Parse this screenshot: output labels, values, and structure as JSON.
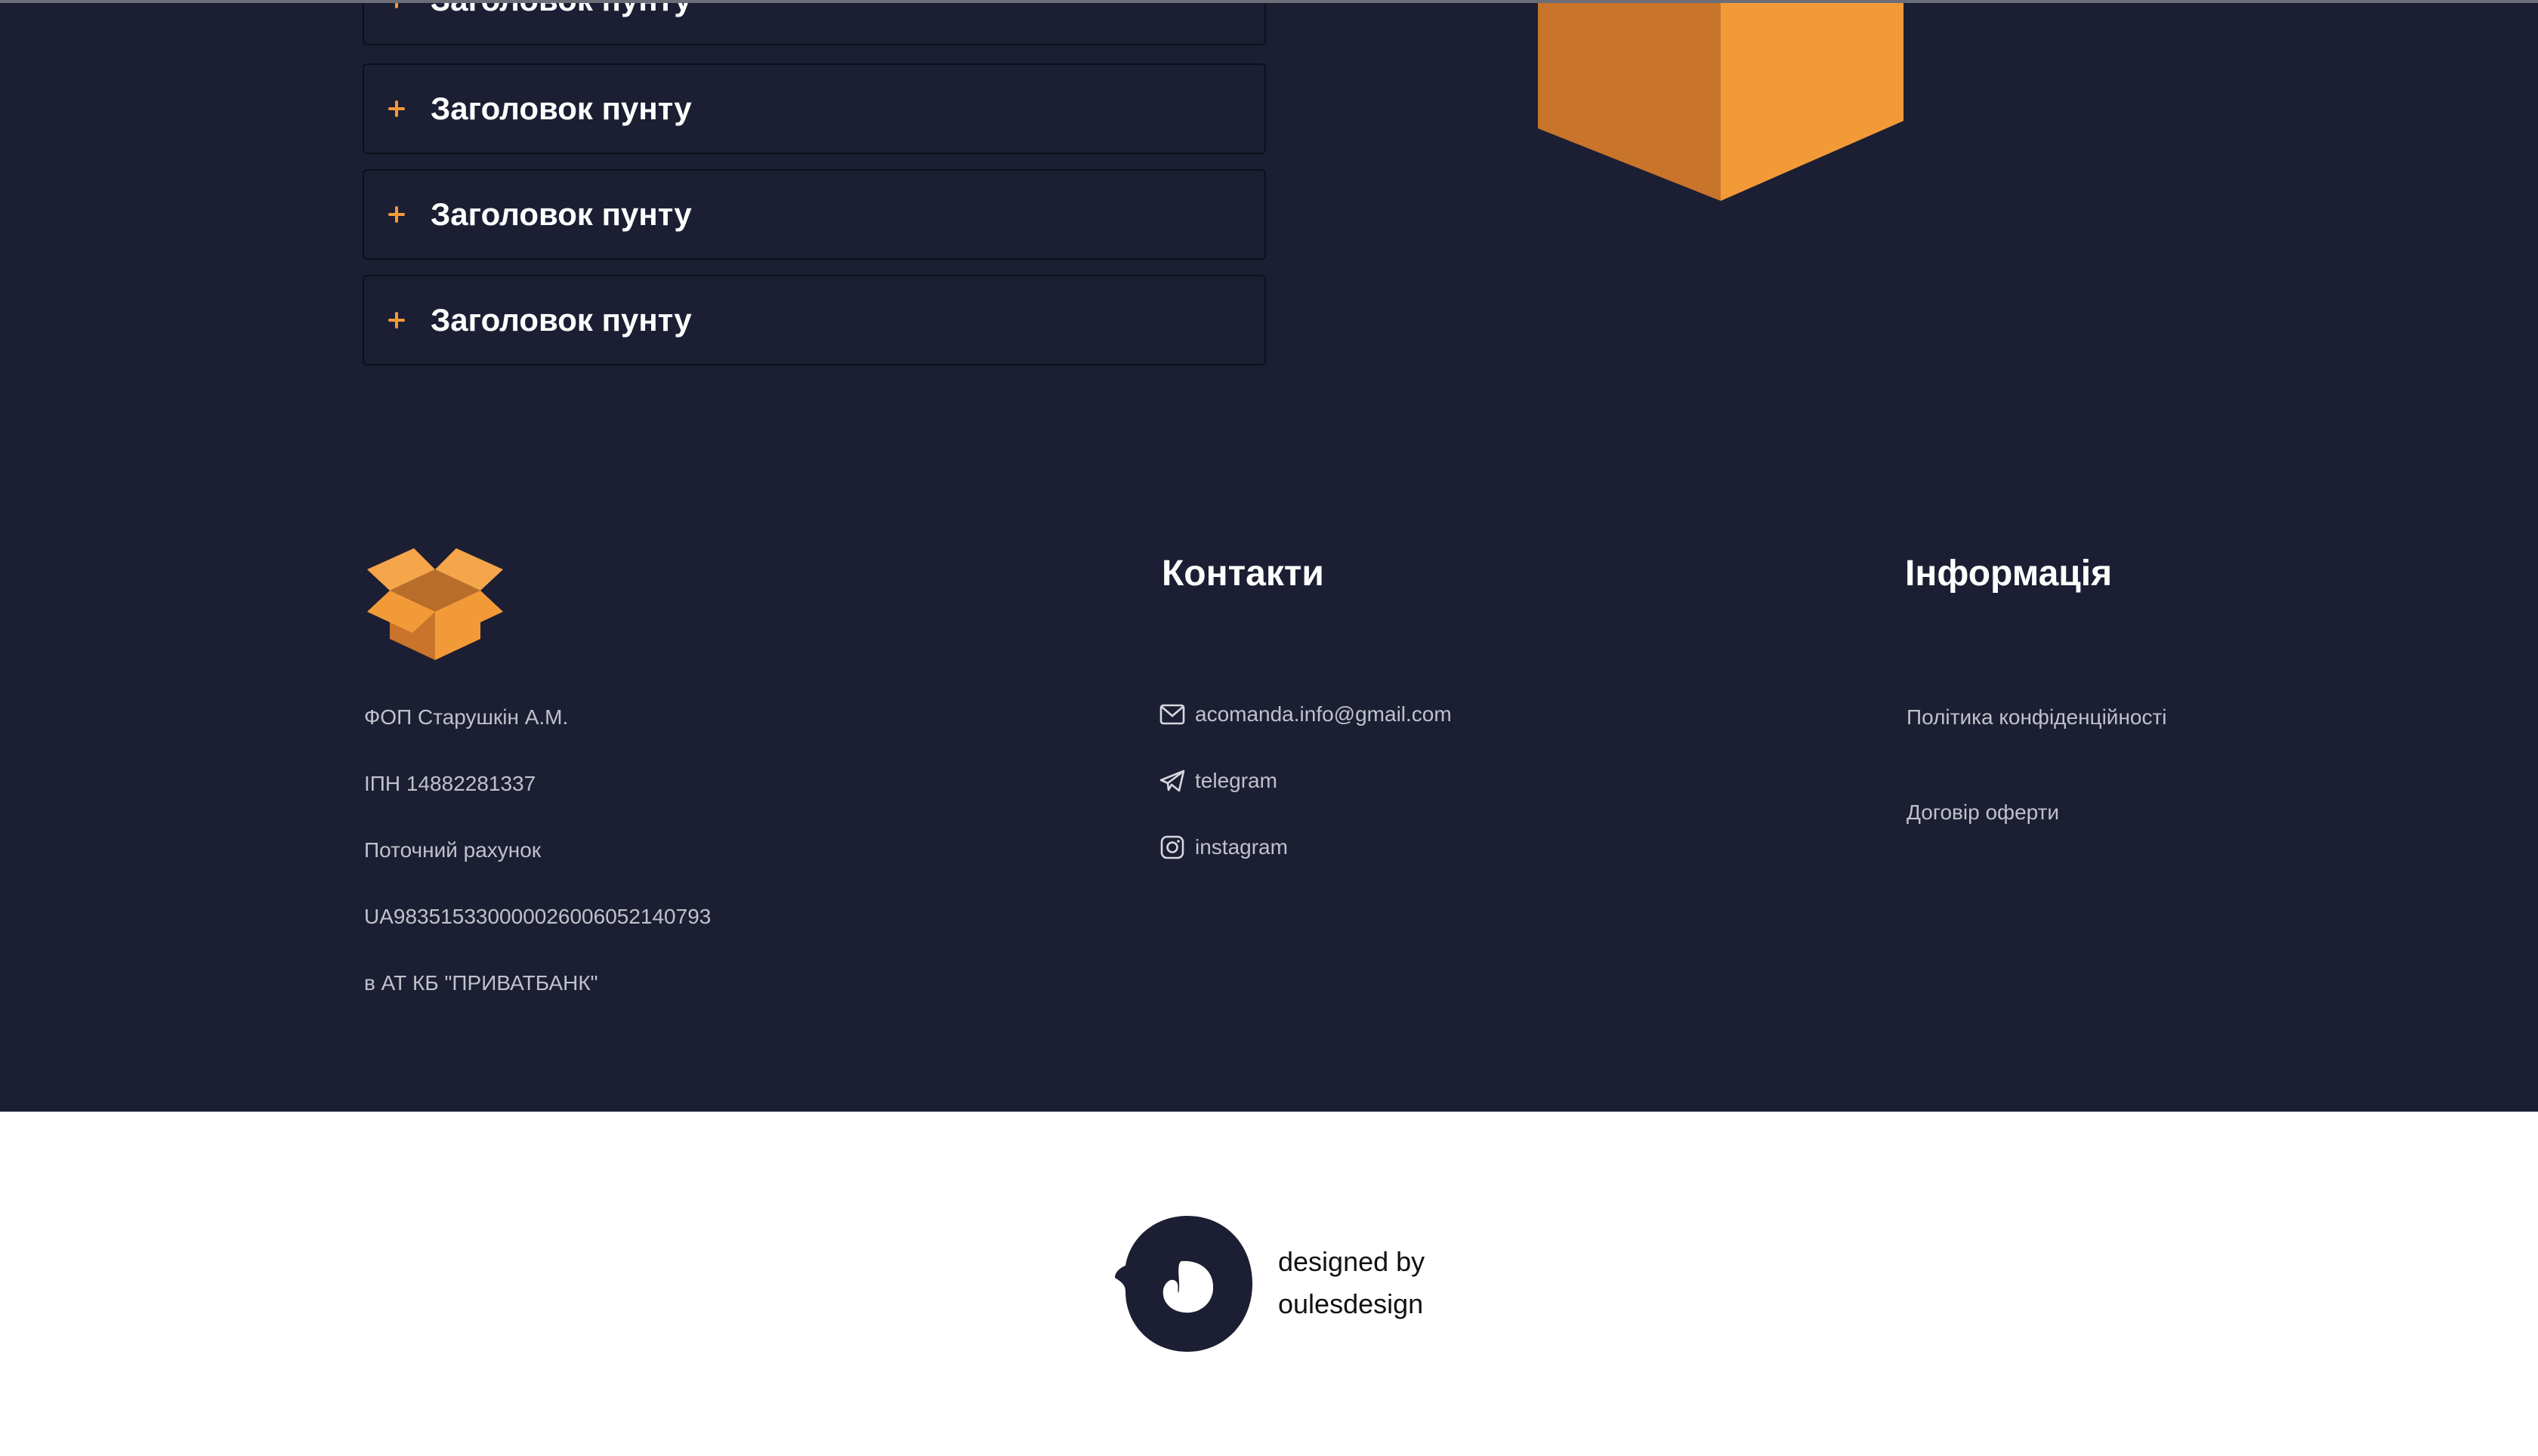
{
  "accordion": {
    "items": [
      {
        "title": "Заголовок пунту"
      },
      {
        "title": "Заголовок пунту"
      },
      {
        "title": "Заголовок пунту"
      },
      {
        "title": "Заголовок пунту"
      }
    ]
  },
  "colors": {
    "background": "#1c1f33",
    "accent": "#f39a38",
    "accent_dark": "#c8742b"
  },
  "footer": {
    "company": {
      "logo_icon": "open-box-icon",
      "lines": [
        "ФОП Старушкін А.М.",
        "ІПН 14882281337",
        "Поточний рахунок",
        "UA983515330000026006052140793",
        "в АТ КБ \"ПРИВАТБАНК\""
      ]
    },
    "contacts": {
      "title": "Контакти",
      "email": {
        "icon": "mail-icon",
        "label": "acomanda.info@gmail.com"
      },
      "telegram": {
        "icon": "telegram-icon",
        "label": "telegram"
      },
      "instagram": {
        "icon": "instagram-icon",
        "label": "instagram"
      }
    },
    "info": {
      "title": "Інформація",
      "privacy": "Політика конфіденційності",
      "offer": "Договір оферти"
    }
  },
  "credit": {
    "line1": "designed by",
    "line2": "oulesdesign"
  }
}
